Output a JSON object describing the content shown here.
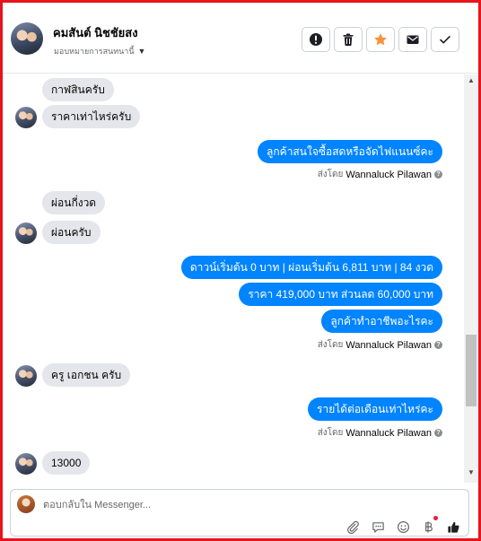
{
  "header": {
    "contact_name": "คมสันต์ นิชชัยสง",
    "assign_label": "มอบหมายการสนทนานี้",
    "actions": [
      {
        "name": "report-button",
        "icon": "alert-icon"
      },
      {
        "name": "delete-button",
        "icon": "trash-icon"
      },
      {
        "name": "star-button",
        "icon": "star-icon",
        "color": "#f7923a"
      },
      {
        "name": "mark-unread-button",
        "icon": "envelope-icon"
      },
      {
        "name": "done-button",
        "icon": "check-icon"
      }
    ]
  },
  "messages": [
    {
      "side": "in",
      "text": "กาฬสินครับ"
    },
    {
      "side": "in",
      "text": "ราคาเท่าไหร่ครับ"
    },
    {
      "side": "out",
      "text": "ลูกค้าสนใจซื้อสดหรือจัดไฟแนนซ์คะ"
    },
    {
      "side": "in",
      "text": "ผ่อนกี่งวด"
    },
    {
      "side": "in",
      "text": "ผ่อนครับ"
    },
    {
      "side": "out",
      "text": "ดาวน์เริ่มต้น 0 บาท | ผ่อนเริ่มต้น 6,811 บาท | 84 งวด"
    },
    {
      "side": "out",
      "text": "ราคา 419,000 บาท  ส่วนลด 60,000 บาท"
    },
    {
      "side": "out",
      "text": "ลูกค้าทำอาชีพอะไรคะ"
    },
    {
      "side": "in",
      "text": "ครู เอกชน ครับ"
    },
    {
      "side": "out",
      "text": "รายได้ต่อเดือนเท่าไหร่คะ"
    },
    {
      "side": "in",
      "text": "13000"
    }
  ],
  "sent_by": {
    "prefix": "ส่งโดย",
    "agent": "Wannaluck Pilawan",
    "help": "?"
  },
  "composer": {
    "placeholder": "ตอบกลับใน Messenger..."
  },
  "colors": {
    "outgoing": "#0084ff",
    "incoming": "#e4e6eb",
    "frame": "#e8141b",
    "like": "#1877f2"
  }
}
